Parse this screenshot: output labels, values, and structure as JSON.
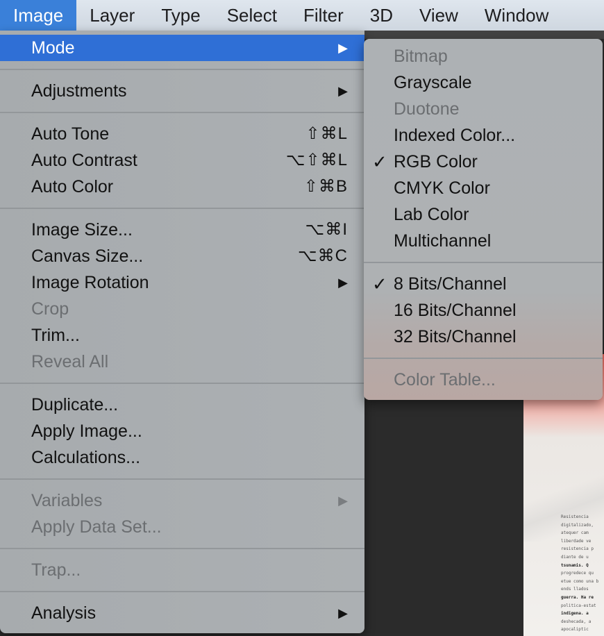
{
  "menubar": {
    "items": [
      "Image",
      "Layer",
      "Type",
      "Select",
      "Filter",
      "3D",
      "View",
      "Window"
    ],
    "active": "Image"
  },
  "image_menu": {
    "groups": [
      [
        {
          "label": "Mode",
          "submenu": true,
          "highlighted": true
        }
      ],
      [
        {
          "label": "Adjustments",
          "submenu": true
        }
      ],
      [
        {
          "label": "Auto Tone",
          "shortcut": "⇧⌘L"
        },
        {
          "label": "Auto Contrast",
          "shortcut": "⌥⇧⌘L"
        },
        {
          "label": "Auto Color",
          "shortcut": "⇧⌘B"
        }
      ],
      [
        {
          "label": "Image Size...",
          "shortcut": "⌥⌘I"
        },
        {
          "label": "Canvas Size...",
          "shortcut": "⌥⌘C"
        },
        {
          "label": "Image Rotation",
          "submenu": true
        },
        {
          "label": "Crop",
          "disabled": true
        },
        {
          "label": "Trim..."
        },
        {
          "label": "Reveal All",
          "disabled": true
        }
      ],
      [
        {
          "label": "Duplicate..."
        },
        {
          "label": "Apply Image..."
        },
        {
          "label": "Calculations..."
        }
      ],
      [
        {
          "label": "Variables",
          "submenu": true,
          "disabled": true
        },
        {
          "label": "Apply Data Set...",
          "disabled": true
        }
      ],
      [
        {
          "label": "Trap...",
          "disabled": true
        }
      ],
      [
        {
          "label": "Analysis",
          "submenu": true
        }
      ]
    ]
  },
  "mode_submenu": {
    "groups": [
      [
        {
          "label": "Bitmap",
          "disabled": true
        },
        {
          "label": "Grayscale"
        },
        {
          "label": "Duotone",
          "disabled": true
        },
        {
          "label": "Indexed Color..."
        },
        {
          "label": "RGB Color",
          "checked": true
        },
        {
          "label": "CMYK Color"
        },
        {
          "label": "Lab Color"
        },
        {
          "label": "Multichannel"
        }
      ],
      [
        {
          "label": "8 Bits/Channel",
          "checked": true
        },
        {
          "label": "16 Bits/Channel"
        },
        {
          "label": "32 Bits/Channel"
        }
      ],
      [
        {
          "label": "Color Table...",
          "disabled": true
        }
      ]
    ]
  },
  "document_text": [
    "Resistencia",
    "digitalizado,",
    "atequer cam",
    "liberdade ve",
    "resistencia p",
    "diante de u",
    "tsunamis. Q",
    "progredece qu",
    "etue como una b",
    "ends llados",
    "guerra. Ha re",
    "politica-estat",
    "indigena. a",
    "deshecada, a",
    "apocaliptic"
  ],
  "icons": {
    "submenu_arrow": "submenu-arrow-icon",
    "checkmark": "checkmark-icon"
  }
}
